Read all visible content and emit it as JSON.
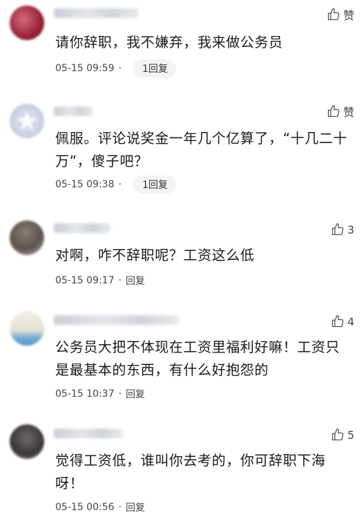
{
  "comments": [
    {
      "text": "请你辞职，我不嫌弃，我来做公务员",
      "time": "05-15 09:59",
      "dot": "·",
      "reply": "1回复",
      "like": "赞"
    },
    {
      "text": "佩服。评论说奖金一年几个亿算了，“十几二十万”，傻子吧？",
      "time": "05-15 09:38",
      "dot": "·",
      "reply": "1回复",
      "like": "赞"
    },
    {
      "text": "对啊，咋不辞职呢？工资这么低",
      "time": "05-15 09:17",
      "dot": "·",
      "reply": "回复",
      "like": "3"
    },
    {
      "text": "公务员大把不体现在工资里福利好嘛！工资只是最基本的东西，有什么好抱怨的",
      "time": "05-15 10:37",
      "dot": "·",
      "reply": "回复",
      "like": "4"
    },
    {
      "text": "觉得工资低，谁叫你去考的，你可辞职下海呀！",
      "time": "05-15 00:56",
      "dot": "·",
      "reply": "回复",
      "like": "5"
    }
  ],
  "icons": {
    "like": "thumbs-up-icon"
  }
}
